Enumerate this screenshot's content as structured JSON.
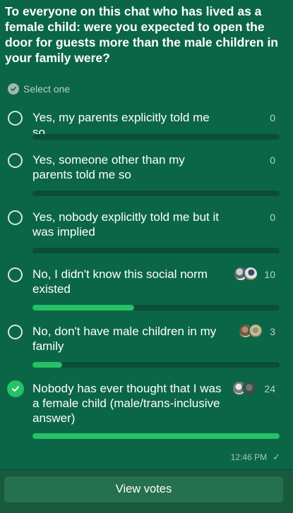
{
  "poll": {
    "question": "To everyone on this chat who has lived as a female child: were you expected to open the door for guests more than the male children in your family were?",
    "instruction": "Select one",
    "options": [
      {
        "label": "Yes, my parents explicitly told me so",
        "count": "0",
        "fraction": 0,
        "selected": false,
        "voter_avatars": []
      },
      {
        "label": "Yes, someone other than my parents told me so",
        "count": "0",
        "fraction": 0,
        "selected": false,
        "voter_avatars": []
      },
      {
        "label": "Yes, nobody explicitly told me but it was implied",
        "count": "0",
        "fraction": 0,
        "selected": false,
        "voter_avatars": []
      },
      {
        "label": "No, I didn't know this social norm existed",
        "count": "10",
        "fraction": 0.41,
        "selected": false,
        "voter_avatars": [
          "avatar",
          "avatar"
        ]
      },
      {
        "label": "No, don't have male children in my family",
        "count": "3",
        "fraction": 0.12,
        "selected": false,
        "voter_avatars": [
          "avatar",
          "avatar"
        ]
      },
      {
        "label": "Nobody has ever thought that I was a female child (male/trans-inclusive answer)",
        "count": "24",
        "fraction": 1.0,
        "selected": true,
        "voter_avatars": [
          "avatar",
          "avatar"
        ]
      }
    ]
  },
  "message": {
    "time": "12:46 PM",
    "status_icon": "check-icon"
  },
  "actions": {
    "view_votes_label": "View votes"
  },
  "colors": {
    "bubble": "#0b6647",
    "background": "#175a3e",
    "accent": "#25c266",
    "track": "#0a4e34"
  }
}
